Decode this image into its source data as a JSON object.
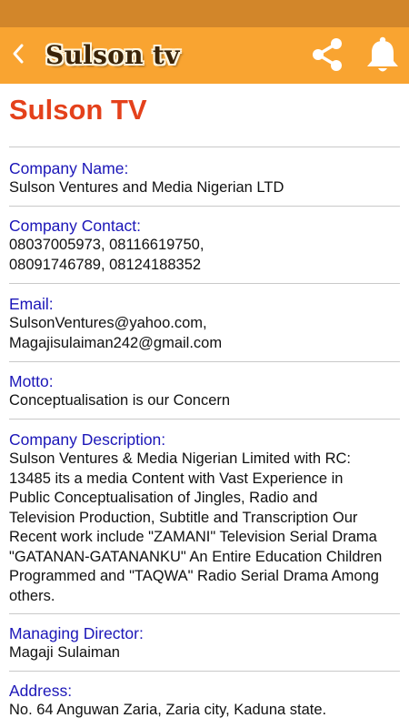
{
  "app_bar": {
    "logo_text": "Sulson tv",
    "back_icon": "chevron-left-icon",
    "share_icon": "share-icon",
    "bell_icon": "bell-icon"
  },
  "colors": {
    "status_bar": "#d2862a",
    "app_bar": "#f9a431",
    "title": "#e4411b",
    "label": "#1b16b8",
    "value": "#111111"
  },
  "page": {
    "title": "Sulson TV"
  },
  "fields": {
    "company_name": {
      "label": "Company Name:",
      "value": "Sulson Ventures and Media Nigerian LTD"
    },
    "company_contact": {
      "label": "Company Contact:",
      "value": "08037005973, 08116619750,\n08091746789, 08124188352"
    },
    "email": {
      "label": "Email:",
      "value": "SulsonVentures@yahoo.com,\nMagajisulaiman242@gmail.com"
    },
    "motto": {
      "label": "Motto:",
      "value": "Conceptualisation is our Concern"
    },
    "company_description": {
      "label": "Company Description:",
      "value": "Sulson Ventures & Media Nigerian Limited with RC:\n13485 its a media Content with Vast Experience in\nPublic Conceptualisation of Jingles, Radio and\nTelevision Production, Subtitle and Transcription Our\nRecent work include \"ZAMANI\" Television Serial Drama\n\"GATANAN-GATANANKU\" An Entire Education Children\nProgrammed and \"TAQWA\" Radio Serial Drama Among\nothers."
    },
    "managing_director": {
      "label": "Managing Director:",
      "value": "Magaji Sulaiman"
    },
    "address": {
      "label": "Address:",
      "value": "No. 64 Anguwan Zaria, Zaria city, Kaduna state."
    }
  }
}
